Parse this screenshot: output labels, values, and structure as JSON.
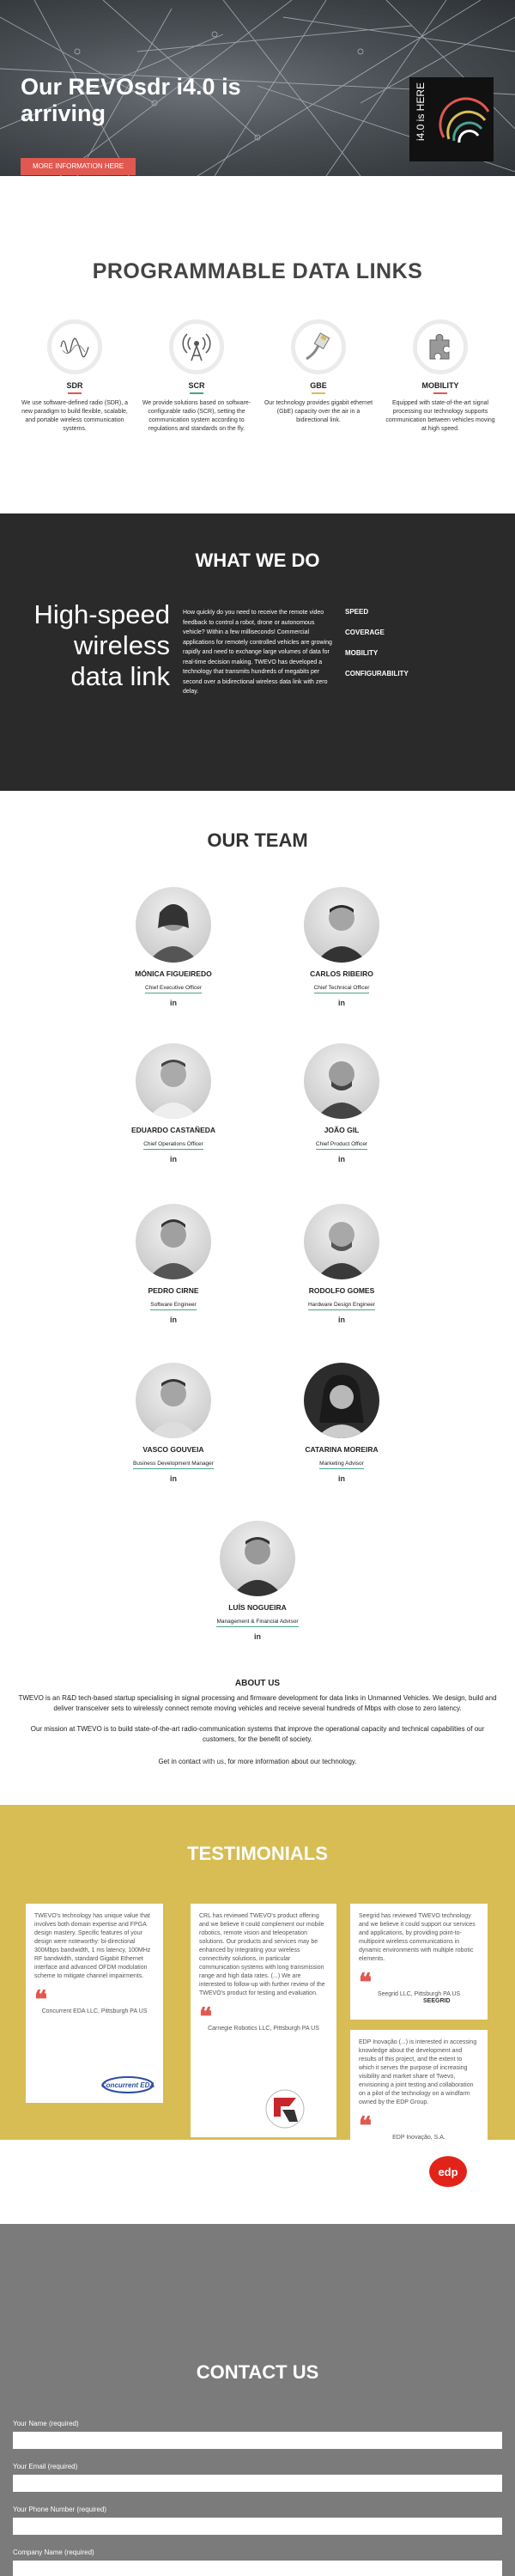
{
  "hero": {
    "title": "Our REVOsdr i4.0 is arriving",
    "button_label": "MORE INFORMATION HERE",
    "book_spine": "i4.0 is HERE"
  },
  "links": {
    "title": "PROGRAMMABLE DATA LINKS",
    "items": [
      {
        "name": "SDR",
        "text": "We use software-defined radio (SDR), a new paradigm to build flexible, scalable, and portable wireless communication systems.",
        "icon": "waveform-icon",
        "color": "#e0584f"
      },
      {
        "name": "SCR",
        "text": "We provide solutions based on software-configurable radio (SCR), setting the communication system according to regulations and standards on the fly.",
        "icon": "antenna-icon",
        "color": "#49a28f"
      },
      {
        "name": "GBE",
        "text": "Our technology provides gigabit ethernet (GbE) capacity over the air in a bidirectional link.",
        "icon": "ethernet-cable-icon",
        "color": "#d8bd54"
      },
      {
        "name": "MOBILITY",
        "text": "Equipped with state-of-the-art signal processing our technology supports communication between vehicles moving at high speed.",
        "icon": "puzzle-icon",
        "color": "#e0584f"
      }
    ]
  },
  "whatwedo": {
    "title": "WHAT WE DO",
    "headline": "High-speed wireless data link",
    "paragraph": "How quickly do you need to receive the remote video feedback to control a robot, drone or autonomous vehicle? Within a few milliseconds! Commercial applications for remotely controlled vehicles are growing rapidly and need to exchange large volumes of data for real-time decision making. TWEVO has developed a technology that transmits hundreds of megabits per second over a bidirectional wireless data link with zero delay.",
    "features": [
      "SPEED",
      "COVERAGE",
      "MOBILITY",
      "CONFIGURABILITY"
    ]
  },
  "team": {
    "title": "OUR TEAM",
    "linkedin_label": "in",
    "members": [
      {
        "name": "MÓNICA FIGUEIREDO",
        "role": "Chief Executive Officer"
      },
      {
        "name": "CARLOS RIBEIRO",
        "role": "Chief Technical Officer"
      },
      {
        "name": "EDUARDO CASTAÑEDA",
        "role": "Chief Operations Officer"
      },
      {
        "name": "JOÃO GIL",
        "role": "Chief Product Officer"
      },
      {
        "name": "PEDRO CIRNE",
        "role": "Software Engineer"
      },
      {
        "name": "RODOLFO GOMES",
        "role": "Hardware Design Engineer"
      },
      {
        "name": "VASCO GOUVEIA",
        "role": "Business Development Manager"
      },
      {
        "name": "CATARINA MOREIRA",
        "role": "Marketing Advisor"
      },
      {
        "name": "LUÍS NOGUEIRA",
        "role": "Management & Financial Advisor"
      }
    ]
  },
  "about": {
    "title": "ABOUT US",
    "p1": "TWEVO is an R&D tech-based startup specialising in signal processing and firmware development for data links in Unmanned Vehicles. We design, build and deliver transceiver sets to wirelessly connect remote moving vehicles and receive several hundreds of Mbps with close to zero latency.",
    "p2": "Our mission at TWEVO is to build state-of-the-art radio-communication systems that improve the operational capacity and technical capabilities of our customers, for the benefit of society.",
    "p3_prefix": "Get in contact ",
    "p3_link": "with us",
    "p3_suffix": ", for more information about our technology."
  },
  "testimonials": {
    "title": "TESTIMONIALS",
    "items": [
      {
        "text": "TWEVO's technology has unique value that involves both domain expertise and FPGA design mastery. Specific features of your design were noteworthy: bi-directional 300Mbps bandwidth, 1 ms latency, 100MHz RF bandwidth, standard Gigabit Ethernet interface and advanced OFDM modulation scheme to mitigate channel impairments.",
        "author": "Concurrent EDA LLC, Pittsburgh PA US",
        "logo": "Concurrent EDA"
      },
      {
        "text": "CRL has reviewed TWEVO's product offering and we believe it could complement our mobile robotics, remote vision and teleoperation solutions. Our products and services may be enhanced by integrating your wireless connectivity solutions, in particular communication systems with long transmission range and high data rates. (...) We are interested to follow-up with further review of the TWEVO's product for testing and evaluation.",
        "author": "Carnegie Robotics LLC, Pittsburgh PA US",
        "logo": "CR"
      },
      {
        "text": "Seegrid has reviewed TWEVO technology and we believe it could support our services and applications, by providing point-to-multipoint wireless communications in dynamic environments with multiple robotic elements.",
        "author": "Seegrid LLC, Pittsburgh PA US",
        "logo": "SEEGRID"
      },
      {
        "text": "EDP Inovação (...) is interested in accessing knowledge about the development and results of this project, and the extent to which it serves the purpose of increasing visibility and market share of Twevo, envisioning a joint testing and collaboration on a pilot of the technology on a windfarm owned by the EDP Group.",
        "author": "EDP Inovação, S.A.",
        "logo": "edp"
      }
    ]
  },
  "contact": {
    "title": "CONTACT US",
    "fields": [
      "Your Name (required)",
      "Your Email (required)",
      "Your Phone Number (required)",
      "Company Name (required)"
    ]
  },
  "colors": {
    "accent_red": "#e0584f",
    "accent_teal": "#49a28f",
    "accent_gold": "#d8bd54",
    "dark": "#2a2a2a",
    "contact_gray": "#7b7b7b"
  }
}
